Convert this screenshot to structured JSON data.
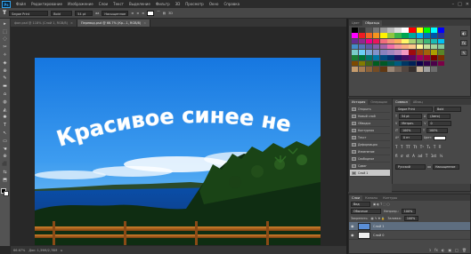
{
  "menu": {
    "logo": "Ps",
    "items": [
      "Файл",
      "Редактирование",
      "Изображение",
      "Слои",
      "Текст",
      "Выделение",
      "Фильтр",
      "3D",
      "Просмотр",
      "Окно",
      "Справка"
    ],
    "window_buttons": [
      "–",
      "□",
      "✕"
    ]
  },
  "options": {
    "tool_label": "T",
    "font": "Segoe Print",
    "style": "Bold",
    "size": "54 pt",
    "aa": "aa",
    "mode": "Насыщенное",
    "extra": "3D"
  },
  "tabs": [
    {
      "label": "фон.psd @ 118% (Слой 1, RGB/8)",
      "close": "×"
    },
    {
      "label": "Перевод.psd @ 66.7% (Кр...1, RGB/8)",
      "close": "×"
    }
  ],
  "document": {
    "title_text": "Красивое синее небо!",
    "colors": {
      "sky_top": "#1a83e8",
      "sky_bottom": "#63b8f2",
      "sea": "#0c4fa0",
      "forest": "#0e2a10",
      "rail": "#b5611c"
    }
  },
  "status": {
    "zoom": "66.67%",
    "doc": "Док: 1,39M/2,78M"
  },
  "swatches_panel": {
    "tabs": [
      "Цвет",
      "Образцы"
    ],
    "colors": [
      "#000000",
      "#333333",
      "#555555",
      "#777777",
      "#999999",
      "#bbbbbb",
      "#dddddd",
      "#ffffff",
      "#ff0000",
      "#ffff00",
      "#00ff00",
      "#00ffff",
      "#0000ff",
      "#ff00ff",
      "#ed1c24",
      "#f26522",
      "#f7941d",
      "#fff200",
      "#8dc63f",
      "#39b54a",
      "#00a651",
      "#00a99d",
      "#00aeef",
      "#0072bc",
      "#0054a6",
      "#2e3192",
      "#662d91",
      "#92278f",
      "#ec008c",
      "#ed145b",
      "#f26d7d",
      "#f69679",
      "#fbaf5d",
      "#fff568",
      "#acd373",
      "#7cc576",
      "#3bb878",
      "#1abbb4",
      "#00bff3",
      "#438ccb",
      "#5574b9",
      "#605ca8",
      "#855fa8",
      "#a864a8",
      "#f06eaa",
      "#f5989d",
      "#f9ad81",
      "#fdc68a",
      "#fff799",
      "#c4df9b",
      "#a3d39c",
      "#82ca9c",
      "#7accc8",
      "#6dcff6",
      "#7da7d9",
      "#8393ca",
      "#8781bd",
      "#a186be",
      "#bd8cbf",
      "#f49ac1",
      "#9e0b0f",
      "#a0410d",
      "#a3620a",
      "#aba000",
      "#598527",
      "#1a7b30",
      "#007236",
      "#00746b",
      "#0076a3",
      "#004a80",
      "#003471",
      "#1b1464",
      "#440e62",
      "#630460",
      "#9e005d",
      "#9e0039",
      "#790000",
      "#7b2e00",
      "#7d4900",
      "#827b00",
      "#406618",
      "#005e20",
      "#005826",
      "#005952",
      "#005b7f",
      "#003663",
      "#002157",
      "#0d004c",
      "#32004b",
      "#4b0049",
      "#7b0046",
      "#c69c6d",
      "#a67c52",
      "#8c6239",
      "#754c24",
      "#603813",
      "#998675",
      "#736357",
      "#534741",
      "#362f2d",
      "#c7b299",
      "#a0a0a0",
      "#6c6c6c"
    ]
  },
  "history_panel": {
    "tabs": [
      "История",
      "Операции"
    ],
    "rows": [
      "Открыть",
      "Новый слой",
      "Обводка",
      "Контурная",
      "Текст",
      "Деформация",
      "Изменение",
      "Свободное",
      "Сдвиг",
      "Слой 1"
    ],
    "selected_index": 9
  },
  "character_panel": {
    "tabs": [
      "Символ",
      "Абзац"
    ],
    "font": "Segoe Print",
    "style": "Bold",
    "size": "54 pt",
    "leading": "(Авто)",
    "tracking": "0",
    "kerning": "Метрич.",
    "vscale": "100%",
    "hscale": "100%",
    "baseline": "0 пт",
    "color_label": "Цвет:",
    "glyphs": [
      "T",
      "T",
      "TT",
      "Tt",
      "T¹",
      "T₁",
      "T",
      "T̶"
    ],
    "glyphs2": [
      "fi",
      "ơ",
      "st",
      "A",
      "ad",
      "T",
      "1st",
      "½"
    ],
    "language": "Русский",
    "aa_mode": "Насыщенное"
  },
  "layers_panel": {
    "tabs": [
      "Слои",
      "Каналы",
      "Контуры"
    ],
    "kind": "Вид",
    "blend": "Обычные",
    "opacity_label": "Непрозр.:",
    "opacity": "100%",
    "lock_label": "Закрепить:",
    "fill_label": "Заливка:",
    "fill": "100%",
    "layers": [
      {
        "name": "Слой 1",
        "selected": true,
        "color": "#5a8ed6"
      },
      {
        "name": "Слой 0",
        "selected": false,
        "color": "#eeeeee"
      }
    ],
    "buttons": [
      "ↄ",
      "fx",
      "◐",
      "▣",
      "□",
      "🗑"
    ]
  },
  "tools": [
    "▸",
    "⬚",
    "◌",
    "✂",
    "✧",
    "◈",
    "⊕",
    "✎",
    "▬",
    "⌂",
    "◍",
    "◭",
    "✺",
    "T",
    "↖",
    "▭",
    "☚",
    "⊕",
    "⬛",
    "⇆",
    "⬒"
  ]
}
